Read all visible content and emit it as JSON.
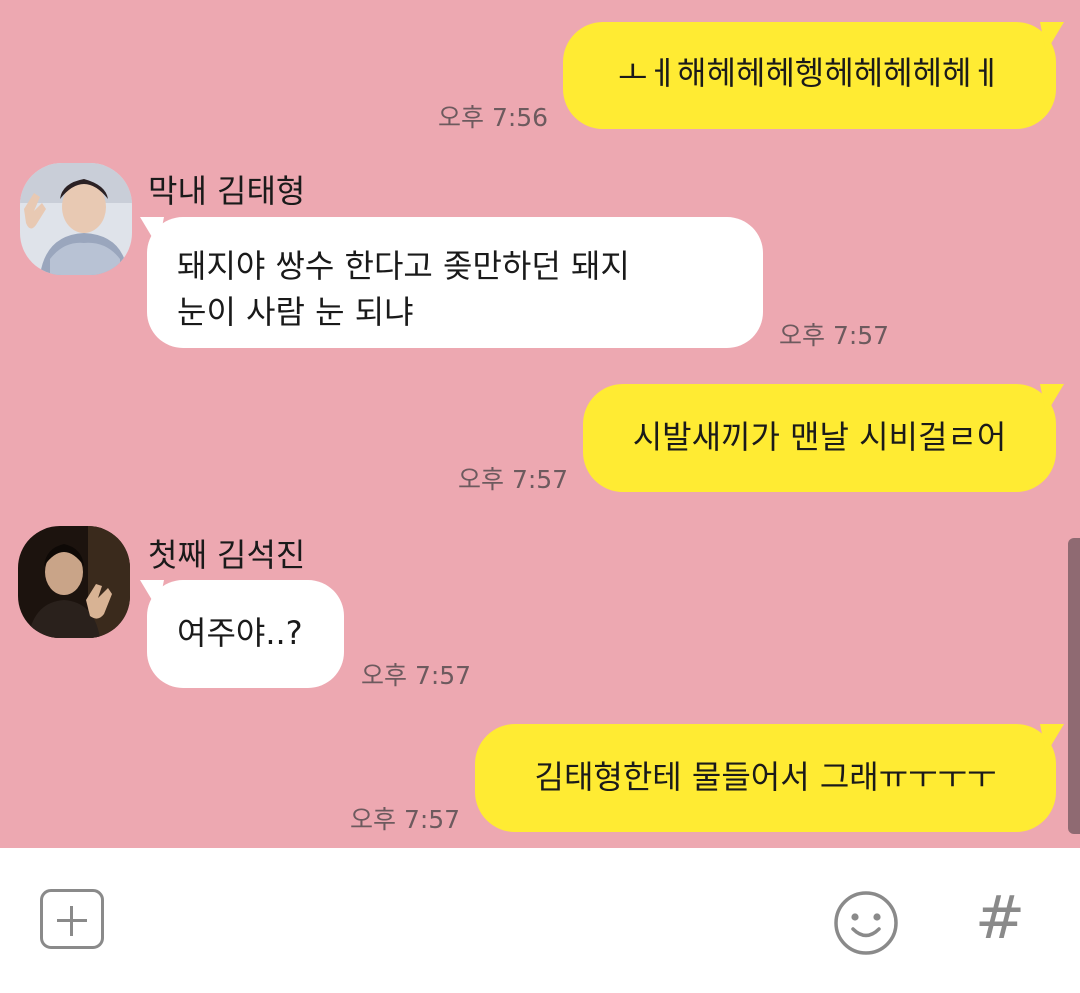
{
  "theme": {
    "background": "#eda8b1",
    "outgoing_bubble": "#ffeb33",
    "incoming_bubble": "#ffffff",
    "input_bar": "#ffffff",
    "icon_gray": "#8a8a8a"
  },
  "messages": [
    {
      "direction": "outgoing",
      "text": "ㅗㅔ해헤헤헤헹헤헤헤헤헤ㅔ",
      "time": "오후 7:56"
    },
    {
      "direction": "incoming",
      "sender": "막내 김태형",
      "avatar": "avatar-photo-kim-taehyung",
      "lines": [
        "돼지야 쌍수 한다고 좆만하던 돼지",
        "눈이 사람 눈 되냐"
      ],
      "time": "오후 7:57"
    },
    {
      "direction": "outgoing",
      "text": "시발새끼가 맨날 시비걸ㄹ어",
      "time": "오후 7:57"
    },
    {
      "direction": "incoming",
      "sender": "첫째 김석진",
      "avatar": "avatar-photo-kim-seokjin",
      "lines": [
        "여주야..?"
      ],
      "time": "오후 7:57"
    },
    {
      "direction": "outgoing",
      "text": "김태형한테 물들어서 그래ㅠㅜㅜㅜ",
      "time": "오후 7:57"
    }
  ],
  "input_bar": {
    "plus_icon": "plus-icon",
    "emoji_icon": "smiley-icon",
    "hash_symbol": "#"
  }
}
